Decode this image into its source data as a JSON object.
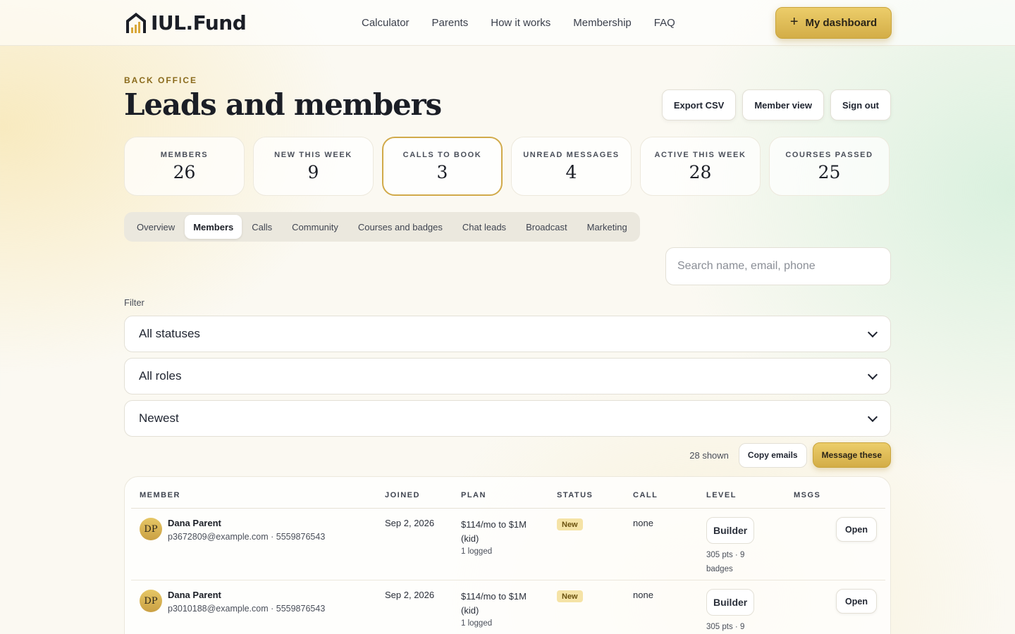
{
  "brand": {
    "name": "IUL.Fund",
    "logo_icon": "house-chart-logo"
  },
  "nav": {
    "items": [
      "Calculator",
      "Parents",
      "How it works",
      "Membership",
      "FAQ"
    ],
    "dashboard_label": "My dashboard",
    "dashboard_icon": "plus-icon"
  },
  "hero": {
    "eyebrow": "BACK OFFICE",
    "title": "Leads and members",
    "buttons": {
      "export": "Export CSV",
      "member_view": "Member view",
      "sign_out": "Sign out"
    }
  },
  "stats": [
    {
      "label": "MEMBERS",
      "value": "26"
    },
    {
      "label": "NEW THIS WEEK",
      "value": "9"
    },
    {
      "label": "CALLS TO BOOK",
      "value": "3",
      "highlight": true
    },
    {
      "label": "UNREAD MESSAGES",
      "value": "4"
    },
    {
      "label": "ACTIVE THIS WEEK",
      "value": "28"
    },
    {
      "label": "COURSES PASSED",
      "value": "25"
    }
  ],
  "tabs": [
    "Overview",
    "Members",
    "Calls",
    "Community",
    "Courses and badges",
    "Chat leads",
    "Broadcast",
    "Marketing"
  ],
  "active_tab": "Members",
  "search": {
    "placeholder": "Search name, email, phone"
  },
  "filter": {
    "label": "Filter",
    "status": "All statuses",
    "role": "All roles",
    "sort": "Newest"
  },
  "actions": {
    "shown": "28 shown",
    "copy_emails": "Copy emails",
    "message_these": "Message these"
  },
  "table": {
    "headers": {
      "member": "MEMBER",
      "joined": "JOINED",
      "plan": "PLAN",
      "status": "STATUS",
      "call": "CALL",
      "level": "LEVEL",
      "msgs": "MSGS"
    },
    "rows": [
      {
        "initials": "DP",
        "name": "Dana Parent",
        "contact": "p3672809@example.com · 5559876543",
        "joined": "Sep 2, 2026",
        "plan_line1": "$114/mo to $1M",
        "plan_line2": "(kid)",
        "plan_sub": "1 logged",
        "status": "New",
        "call": "none",
        "level": "Builder",
        "level_sub": "305 pts · 9 badges",
        "open": "Open"
      },
      {
        "initials": "DP",
        "name": "Dana Parent",
        "contact": "p3010188@example.com · 5559876543",
        "joined": "Sep 2, 2026",
        "plan_line1": "$114/mo to $1M",
        "plan_line2": "(kid)",
        "plan_sub": "1 logged",
        "status": "New",
        "call": "none",
        "level": "Builder",
        "level_sub": "305 pts · 9",
        "open": "Open"
      }
    ]
  },
  "colors": {
    "gold": "#d3ad47",
    "gold_border": "#c9a43c",
    "badge_new_bg": "#f5e3a6"
  }
}
